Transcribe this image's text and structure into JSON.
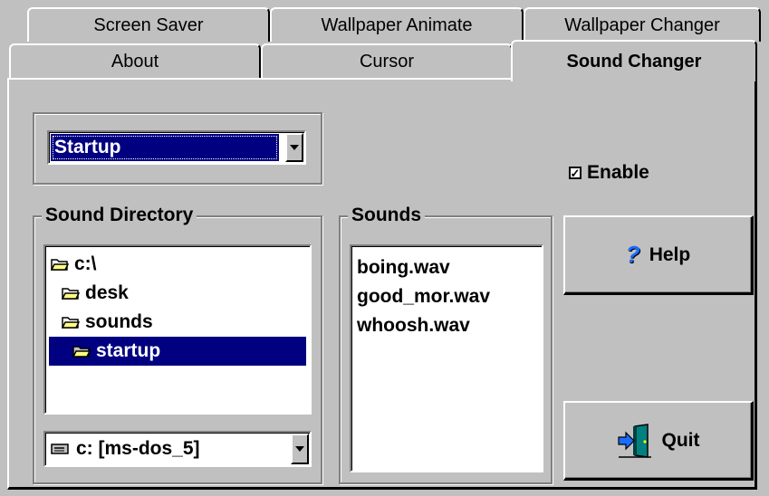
{
  "tabs": {
    "row1": [
      {
        "label": "Screen Saver"
      },
      {
        "label": "Wallpaper Animate"
      },
      {
        "label": "Wallpaper Changer"
      }
    ],
    "row2": [
      {
        "label": "About"
      },
      {
        "label": "Cursor"
      },
      {
        "label": "Sound Changer"
      }
    ]
  },
  "event_select": {
    "value": "Startup"
  },
  "enable": {
    "label": "Enable",
    "checked": true
  },
  "sound_directory": {
    "label": "Sound Directory",
    "folders": [
      {
        "name": "c:\\"
      },
      {
        "name": "desk"
      },
      {
        "name": "sounds"
      },
      {
        "name": "startup"
      }
    ],
    "drive": "c: [ms-dos_5]"
  },
  "sounds": {
    "label": "Sounds",
    "files": [
      "boing.wav",
      "good_mor.wav",
      "whoosh.wav"
    ]
  },
  "buttons": {
    "help": "Help",
    "quit": "Quit"
  },
  "icons": {
    "folder": "folder-icon",
    "help": "question-mark-icon",
    "quit": "exit-door-icon",
    "drive": "drive-icon"
  },
  "colors": {
    "selection": "#000080",
    "face": "#c0c0c0",
    "help_icon": "#1a6cff",
    "door": "#008080"
  }
}
